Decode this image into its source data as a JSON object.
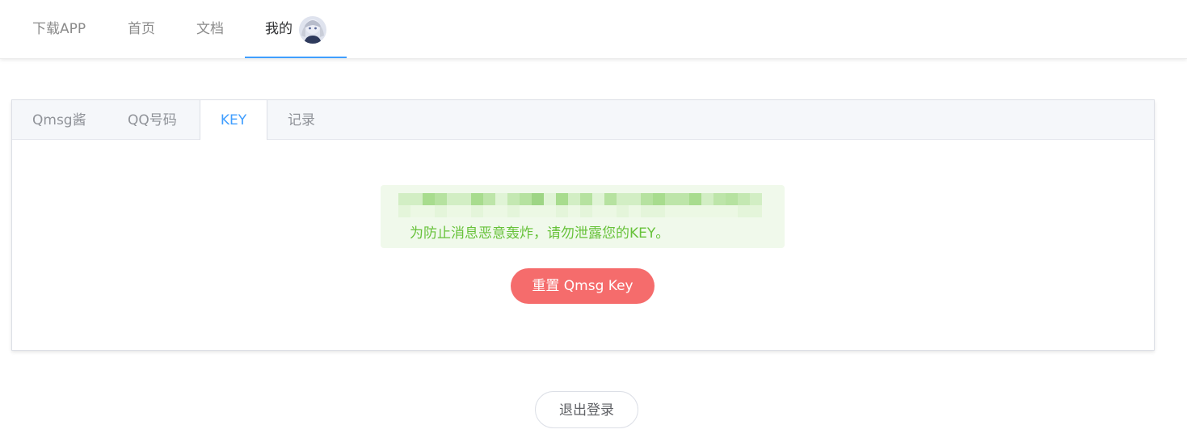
{
  "topnav": {
    "items": [
      {
        "label": "下载APP"
      },
      {
        "label": "首页"
      },
      {
        "label": "文档"
      },
      {
        "label": "我的"
      }
    ],
    "active_index": 3,
    "accent_color": "#409eff"
  },
  "tabs": {
    "items": [
      {
        "label": "Qmsg酱"
      },
      {
        "label": "QQ号码"
      },
      {
        "label": "KEY"
      },
      {
        "label": "记录"
      }
    ],
    "active_index": 2
  },
  "key_panel": {
    "key_value_obscured": true,
    "warning_text": "为防止消息恶意轰炸，请勿泄露您的KEY。",
    "alert_color": "#67c23a",
    "alert_background": "#f0f9eb",
    "reset_button_label": "重置 Qmsg Key",
    "reset_button_color": "#f56c6c"
  },
  "logout": {
    "label": "退出登录"
  }
}
